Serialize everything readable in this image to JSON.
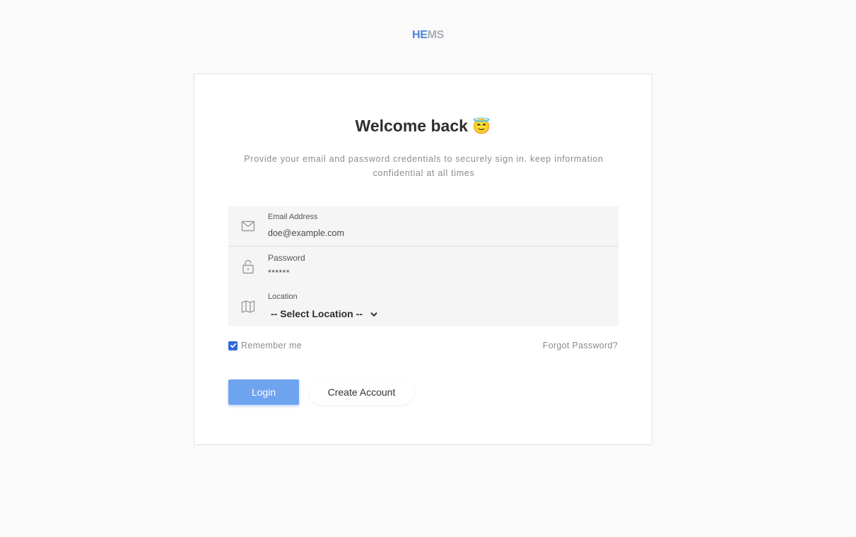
{
  "brand": {
    "part1": "HE",
    "part2": "MS"
  },
  "card": {
    "title": "Welcome back",
    "title_emoji": "😇",
    "subtitle": "Provide your email and password credentials to securely sign in. keep information confidential at all times"
  },
  "form": {
    "email": {
      "label": "Email Address",
      "value": "doe@example.com",
      "icon": "mail-icon"
    },
    "password": {
      "label": "Password",
      "value": "******",
      "icon": "lock-icon"
    },
    "location": {
      "label": "Location",
      "selected": "-- Select Location --",
      "icon": "map-icon"
    }
  },
  "options": {
    "remember_label": "Remember me",
    "remember_checked": true,
    "forgot_label": "Forgot Password?"
  },
  "actions": {
    "login_label": "Login",
    "create_label": "Create Account"
  },
  "colors": {
    "accent": "#4a86d6",
    "login_button": "#6ea3f0",
    "checkbox": "#2f6bd6",
    "background": "#fafafa"
  }
}
